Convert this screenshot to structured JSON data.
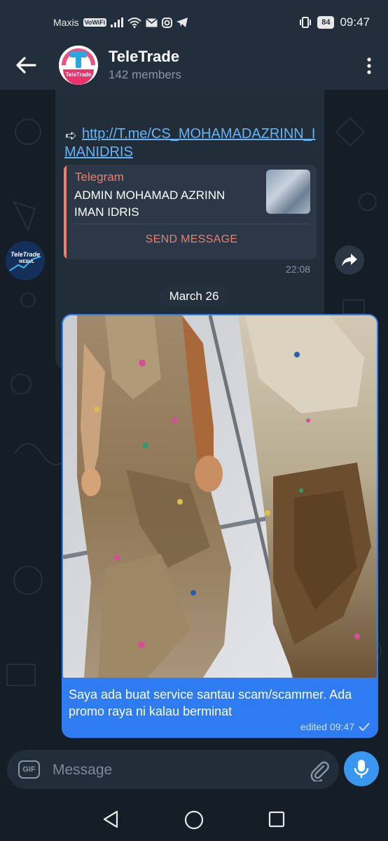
{
  "status_bar": {
    "carrier": "Maxis",
    "vowifi": "VoWiFi",
    "battery": "84",
    "time": "09:47"
  },
  "header": {
    "title": "TeleTrade",
    "subtitle": "142 members",
    "avatar_text": "TeleTrade"
  },
  "incoming_message": {
    "link_prefix": "➪",
    "link": "http://T.me/CS_MOHAMADAZRINN_IMANIDRIS",
    "preview_site": "Telegram",
    "preview_title": "ADMIN MOHAMAD AZRINN IMAN IDRIS",
    "preview_action": "SEND MESSAGE",
    "time": "22:08",
    "sender_avatar_text": "TeleTrade",
    "sender_avatar_sub": "WEBUL"
  },
  "date_separator": "March 26",
  "outgoing_message": {
    "text": "Saya ada buat service santau scam/scammer. Ada promo raya ni kalau berminat",
    "meta": "edited 09:47"
  },
  "input": {
    "gif_label": "GIF",
    "placeholder": "Message"
  },
  "colors": {
    "header_bg": "#232e3c",
    "chat_bg": "#151d26",
    "outgoing_bubble": "#2f7cf2",
    "incoming_bubble": "#222d3a",
    "link": "#6ab3f3",
    "preview_accent": "#ec7f6d",
    "mic_button": "#3a97f0"
  }
}
